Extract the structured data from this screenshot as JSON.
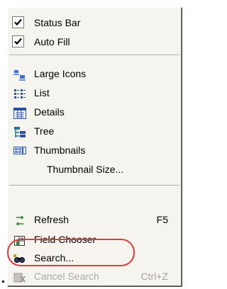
{
  "menu": {
    "items": [
      {
        "label": "Status Bar",
        "checked": true,
        "icon": "checkmark-icon"
      },
      {
        "label": "Auto Fill",
        "checked": true,
        "icon": "checkmark-icon"
      },
      {
        "label": "Large Icons",
        "icon": "large-icons-icon"
      },
      {
        "label": "List",
        "icon": "list-icon"
      },
      {
        "label": "Details",
        "icon": "details-icon"
      },
      {
        "label": "Tree",
        "icon": "tree-icon"
      },
      {
        "label": "Thumbnails",
        "icon": "thumbnails-icon"
      },
      {
        "label": "Thumbnail Size...",
        "icon": ""
      },
      {
        "label": "Refresh",
        "shortcut": "F5",
        "icon": "refresh-icon"
      },
      {
        "label": "Field Chooser",
        "icon": "field-chooser-icon"
      },
      {
        "label": "Search...",
        "icon": "search-icon"
      },
      {
        "label": "Cancel Search",
        "shortcut": "Ctrl+Z",
        "disabled": true,
        "icon": "cancel-search-icon"
      }
    ]
  },
  "annotation": {
    "highlight_color": "#e23a3a"
  }
}
